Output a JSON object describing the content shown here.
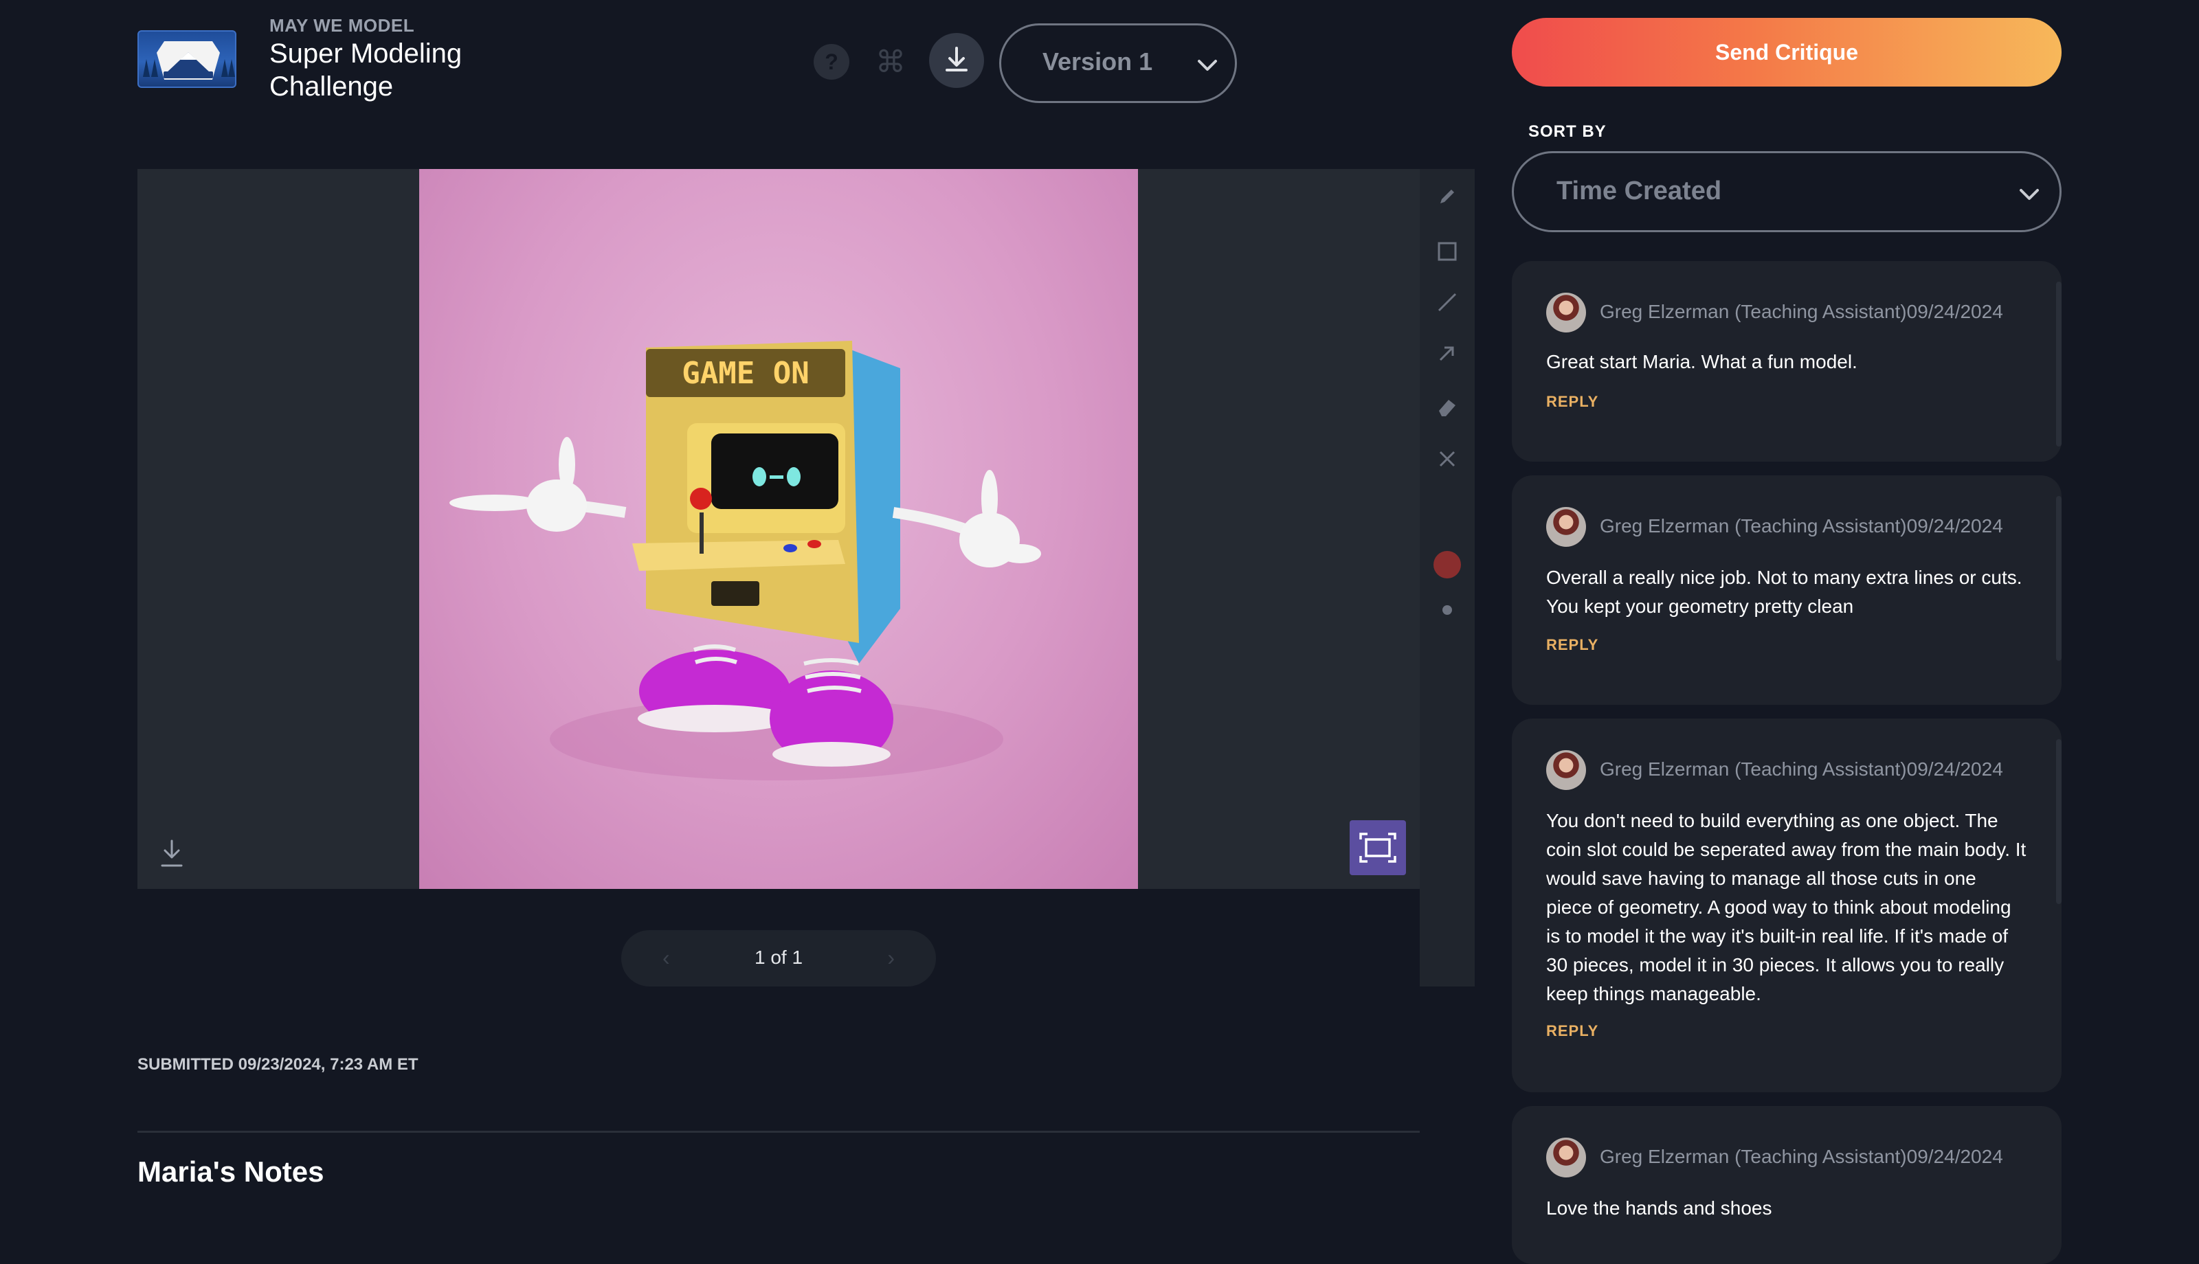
{
  "header": {
    "kicker": "MAY WE MODEL",
    "title": "Super Modeling Challenge",
    "version_label": "Version 1",
    "help_glyph": "?",
    "cmd_glyph": "⌘"
  },
  "viewer": {
    "image_text": "GAME ON",
    "pager": {
      "text": "1 of 1",
      "prev": "‹",
      "next": "›"
    },
    "annotation_color": "#8a2e2e",
    "accent_fit_button": "#5b4ea0"
  },
  "submission": {
    "submitted_text": "SUBMITTED 09/23/2024, 7:23 AM ET",
    "notes_title": "Maria's Notes"
  },
  "sidebar": {
    "send_label": "Send Critique",
    "sort_by_label": "SORT BY",
    "sort_value": "Time Created",
    "comments": [
      {
        "author": "Greg Elzerman (Teaching Assistant)",
        "date": "09/24/2024",
        "text": "Great start Maria. What a fun model.",
        "reply": "REPLY"
      },
      {
        "author": "Greg Elzerman (Teaching Assistant)",
        "date": "09/24/2024",
        "text": "Overall a really nice job. Not to many extra lines or cuts. You kept your geometry pretty clean",
        "reply": "REPLY"
      },
      {
        "author": "Greg Elzerman (Teaching Assistant)",
        "date": "09/24/2024",
        "text": "You don't need to build everything as one object. The coin slot could be seperated away from the main body. It would save having to manage all those cuts in one piece of geometry. A good way to think about modeling is to model it the way it's built-in real life. If it's made of 30 pieces, model it in 30 pieces. It allows you to really keep things manageable.",
        "reply": "REPLY"
      },
      {
        "author": "Greg Elzerman (Teaching Assistant)",
        "date": "09/24/2024",
        "text": "Love the hands and shoes"
      }
    ]
  },
  "colors": {
    "background": "#131722",
    "reply": "#e9b063",
    "send_gradient_start": "#f04c4c",
    "send_gradient_end": "#f7b85a"
  }
}
